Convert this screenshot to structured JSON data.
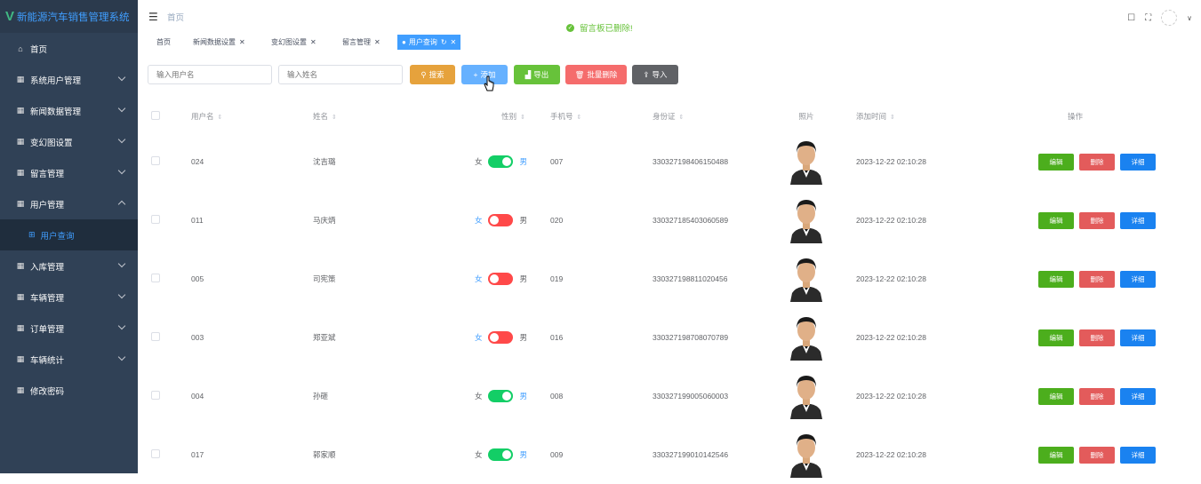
{
  "app": {
    "title": "新能源汽车销售管理系统"
  },
  "sidebar": {
    "items": [
      {
        "icon": "home-icon",
        "label": "首页"
      },
      {
        "icon": "menu-icon",
        "label": "系统用户管理"
      },
      {
        "icon": "menu-icon",
        "label": "新闻数据管理"
      },
      {
        "icon": "menu-icon",
        "label": "变幻图设置"
      },
      {
        "icon": "menu-icon",
        "label": "留言管理"
      },
      {
        "icon": "menu-icon",
        "label": "用户管理"
      },
      {
        "icon": "menu-icon",
        "label": "入库管理"
      },
      {
        "icon": "menu-icon",
        "label": "车辆管理"
      },
      {
        "icon": "menu-icon",
        "label": "订单管理"
      },
      {
        "icon": "menu-icon",
        "label": "车辆统计"
      },
      {
        "icon": "menu-icon",
        "label": "修改密码"
      }
    ],
    "sub_item": {
      "icon": "grid-icon",
      "label": "用户查询"
    }
  },
  "header": {
    "breadcrumb": "首页"
  },
  "tags": [
    {
      "label": "首页"
    },
    {
      "label": "新闻数据设置"
    },
    {
      "label": "变幻图设置"
    },
    {
      "label": "留言管理"
    },
    {
      "label": "用户查询"
    }
  ],
  "toast": {
    "message": "留言板已删除!"
  },
  "search": {
    "username_placeholder": "输入用户名",
    "name_placeholder": "输入姓名"
  },
  "toolbar": {
    "search_label": "搜索",
    "add_label": "添加",
    "export_label": "导出",
    "batch_delete_label": "批量删除",
    "import_label": "导入"
  },
  "table": {
    "columns": [
      "用户名",
      "姓名",
      "性别",
      "手机号",
      "身份证",
      "照片",
      "添加时间",
      "操作"
    ],
    "female_label": "女",
    "male_label": "男",
    "rows": [
      {
        "username": "024",
        "name": "沈吉璐",
        "gender": "男",
        "phone": "007",
        "id_card": "330327198406150488",
        "time": "2023-12-22 02:10:28"
      },
      {
        "username": "011",
        "name": "马庆炳",
        "gender": "女",
        "phone": "020",
        "id_card": "330327185403060589",
        "time": "2023-12-22 02:10:28"
      },
      {
        "username": "005",
        "name": "司宪策",
        "gender": "女",
        "phone": "019",
        "id_card": "330327198811020456",
        "time": "2023-12-22 02:10:28"
      },
      {
        "username": "003",
        "name": "郑亚斌",
        "gender": "女",
        "phone": "016",
        "id_card": "330327198708070789",
        "time": "2023-12-22 02:10:28"
      },
      {
        "username": "004",
        "name": "孙砸",
        "gender": "男",
        "phone": "008",
        "id_card": "330327199005060003",
        "time": "2023-12-22 02:10:28"
      },
      {
        "username": "017",
        "name": "郭家顺",
        "gender": "男",
        "phone": "009",
        "id_card": "330327199010142546",
        "time": "2023-12-22 02:10:28"
      }
    ],
    "edit_label": "编辑",
    "delete_label": "删除",
    "detail_label": "详细"
  },
  "colors": {
    "sidebar_bg": "#304156",
    "primary": "#409eff",
    "success": "#67c23a",
    "danger": "#f56c6c",
    "warning": "#e6a23c",
    "switch_on": "#13ce66",
    "switch_off": "#ff4949"
  }
}
